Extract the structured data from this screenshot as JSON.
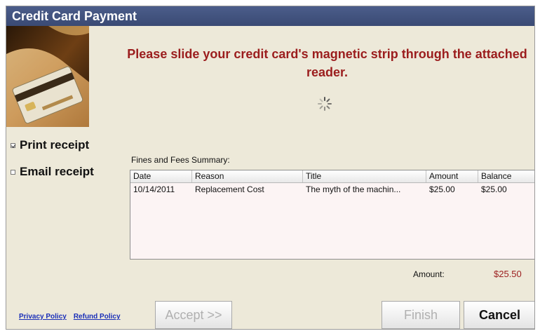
{
  "window": {
    "title": "Credit Card Payment"
  },
  "instruction": "Please slide your credit card's magnetic strip through the attached reader.",
  "receipt_options": [
    {
      "label": "Print receipt",
      "checked": true
    },
    {
      "label": "Email receipt",
      "checked": false
    }
  ],
  "summary": {
    "label": "Fines and Fees Summary:",
    "columns": [
      "Date",
      "Reason",
      "Title",
      "Amount",
      "Balance"
    ],
    "rows": [
      {
        "date": "10/14/2011",
        "reason": "Replacement Cost",
        "title": "The myth of the machin...",
        "amount": "$25.00",
        "balance": "$25.00"
      }
    ]
  },
  "amount": {
    "label": "Amount:",
    "value": "$25.50"
  },
  "links": {
    "privacy": "Privacy Policy",
    "refund": "Refund Policy"
  },
  "buttons": {
    "accept": "Accept >>",
    "finish": "Finish",
    "cancel": "Cancel"
  },
  "colors": {
    "titlebar": "#3a4a74",
    "background": "#ede9d9",
    "accent_red": "#9b1d1d",
    "link_blue": "#1a2fb8"
  },
  "icons": {
    "spinner": "loading-spinner-icon",
    "photo": "credit-card-photo"
  }
}
